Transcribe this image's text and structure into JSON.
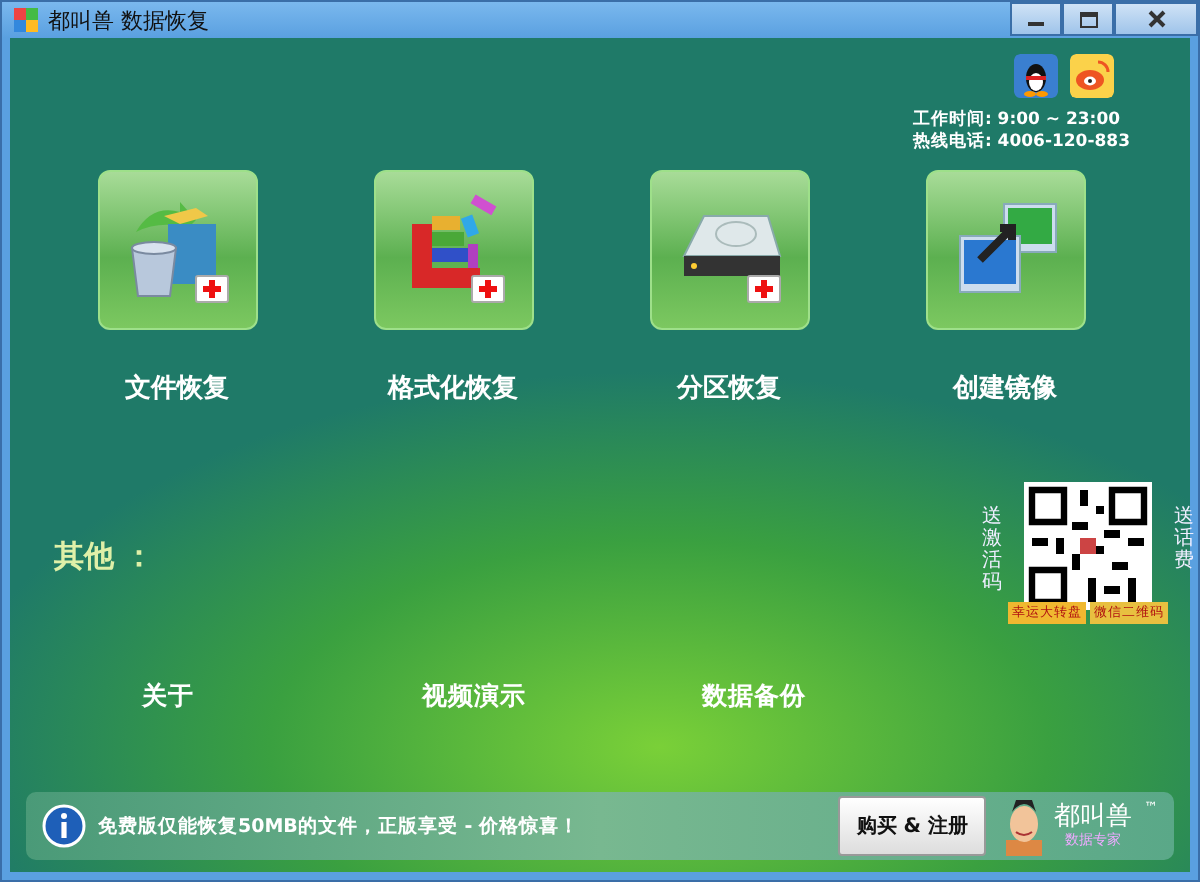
{
  "window": {
    "title": "都叫兽 数据恢复"
  },
  "contact": {
    "hours": "工作时间: 9:00 ~ 23:00",
    "hotline": "热线电话: 4006-120-883"
  },
  "tools": [
    {
      "kind": "file",
      "label": "文件恢复"
    },
    {
      "kind": "format",
      "label": "格式化恢复"
    },
    {
      "kind": "partition",
      "label": "分区恢复"
    },
    {
      "kind": "image",
      "label": "创建镜像"
    }
  ],
  "others": {
    "heading": "其他 ：",
    "links": [
      "关于",
      "视频演示",
      "数据备份"
    ]
  },
  "promo": {
    "left": "送激活码",
    "right": "送话费",
    "ribbon_left": "幸运大转盘",
    "ribbon_right": "微信二维码"
  },
  "notice": {
    "text": "免费版仅能恢复50MB的文件，正版享受 - 价格惊喜！",
    "button": "购买 & 注册"
  },
  "brand": {
    "name": "都叫兽",
    "tagline": "数据专家",
    "tm": "™"
  }
}
